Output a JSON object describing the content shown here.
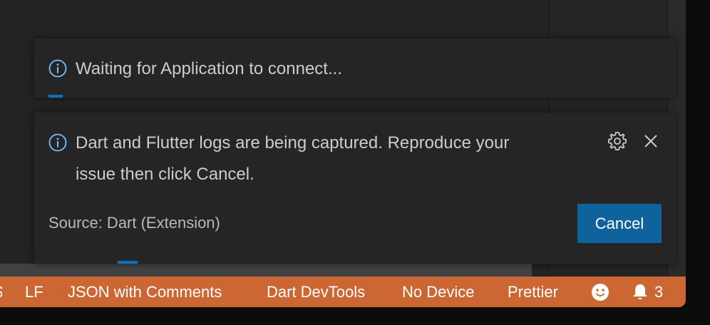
{
  "notifications": [
    {
      "message": "Waiting for Application to connect...",
      "icon": "info-icon"
    },
    {
      "message_line1": "Dart and Flutter logs are being captured. Reproduce your",
      "message_line2": "issue then click Cancel.",
      "icon": "info-icon",
      "source": "Source: Dart (Extension)",
      "cancel_label": "Cancel",
      "actions": [
        "gear-icon",
        "close-icon"
      ]
    }
  ],
  "statusbar": {
    "line_ending": "LF",
    "language": "JSON with Comments",
    "devtools": "Dart DevTools",
    "device": "No Device",
    "formatter": "Prettier",
    "feedback_icon": "smiley-icon",
    "bell_icon": "bell-icon",
    "notification_count": "3"
  },
  "colors": {
    "statusbar": "#cc6633",
    "accent": "#0e70c0",
    "button": "#0e639c",
    "info": "#75beff"
  }
}
